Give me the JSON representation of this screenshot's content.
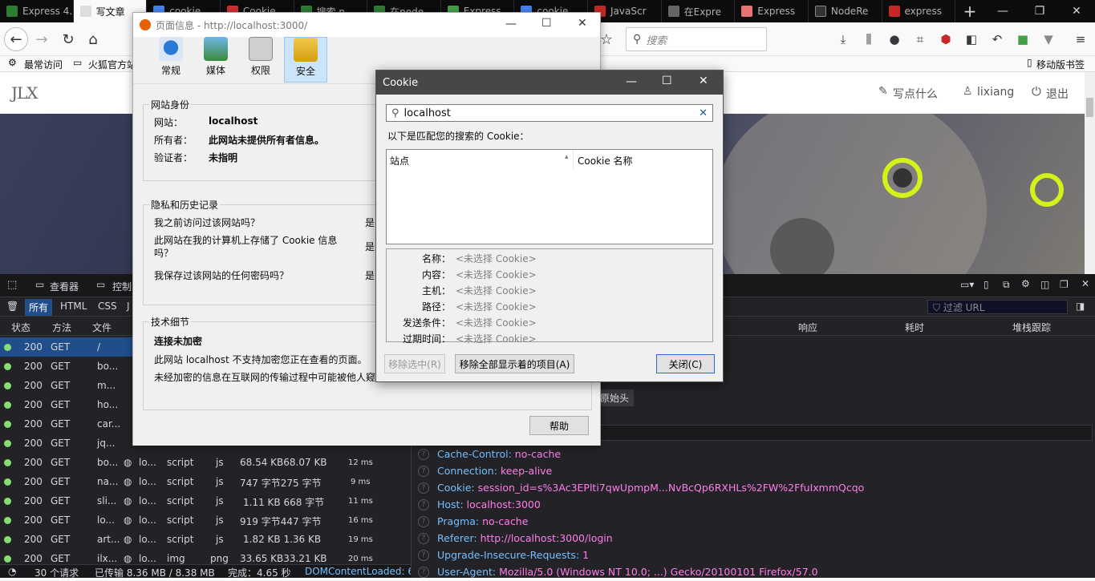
{
  "tabs": [
    {
      "label": "Express 4.x",
      "color": "#2e7d32"
    },
    {
      "label": "写文章",
      "color": "#eeeeee"
    },
    {
      "label": "cookie",
      "color": "#4285f4"
    },
    {
      "label": "Cookie",
      "color": "#d32f2f"
    },
    {
      "label": "搜索 n",
      "color": "#2e7d32"
    },
    {
      "label": "在node",
      "color": "#2e7d32"
    },
    {
      "label": "Express",
      "color": "#43a047"
    },
    {
      "label": "cookie",
      "color": "#4285f4"
    },
    {
      "label": "JavaScr",
      "color": "#c62828"
    },
    {
      "label": "在Expre",
      "color": "#555555"
    },
    {
      "label": "Express",
      "color": "#e57373"
    },
    {
      "label": "NodeRe",
      "color": "#222222"
    },
    {
      "label": "express",
      "color": "#c62828"
    }
  ],
  "toolbar": {
    "search_placeholder": "搜索",
    "mobile_bookmarks": "移动版书签"
  },
  "bookmarks": {
    "item1": "最常访问",
    "item2": "火狐官方站"
  },
  "site": {
    "logo": "JLX",
    "write": "写点什么",
    "user": "lixiang",
    "logout": "退出"
  },
  "pageinfo": {
    "title": "页面信息 - http://localhost:3000/",
    "tabs": [
      "常规",
      "媒体",
      "权限",
      "安全"
    ],
    "identity": {
      "heading": "网站身份",
      "site_label": "网站：",
      "site_value": "localhost",
      "owner_label": "所有者：",
      "owner_value": "此网站未提供所有者信息。",
      "verifier_label": "验证者：",
      "verifier_value": "未指明"
    },
    "privacy": {
      "heading": "隐私和历史记录",
      "q1": "我之前访问过该网站吗？",
      "a1": "是",
      "q2a": "此网站在我的计算机上存储了 Cookie 信息",
      "q2b": "吗？",
      "a2": "是",
      "q3": "我保存过该网站的任何密码吗？",
      "a3": "是"
    },
    "tech": {
      "heading": "技术细节",
      "line1": "连接未加密",
      "line2": "此网站 localhost 不支持加密您正在查看的页面。",
      "line3": "未经加密的信息在互联网的传输过程中可能被他人窥"
    },
    "help": "帮助"
  },
  "cookie": {
    "title": "Cookie",
    "search_value": "localhost",
    "matching_label": "以下是匹配您的搜索的 Cookie：",
    "col_site": "站点",
    "col_name": "Cookie 名称",
    "details": [
      {
        "label": "名称：",
        "value": "<未选择 Cookie>"
      },
      {
        "label": "内容：",
        "value": "<未选择 Cookie>"
      },
      {
        "label": "主机：",
        "value": "<未选择 Cookie>"
      },
      {
        "label": "路径：",
        "value": "<未选择 Cookie>"
      },
      {
        "label": "发送条件：",
        "value": "<未选择 Cookie>"
      },
      {
        "label": "过期时间：",
        "value": "<未选择 Cookie>"
      }
    ],
    "btn_remove_selected": "移除选中(R)",
    "btn_remove_all": "移除全部显示着的项目(A)",
    "btn_close": "关闭(C)"
  },
  "devtools": {
    "inspector": "查看器",
    "console": "控制",
    "filters": [
      "所有",
      "HTML",
      "CSS",
      "J"
    ],
    "filter_url": "过滤 URL",
    "cols": [
      "状态",
      "方法",
      "文件"
    ],
    "right_cols": [
      "响应",
      "耗时",
      "堆栈跟踪"
    ],
    "raw_headers": "原始头",
    "requests": [
      {
        "status": "200",
        "method": "GET",
        "file": "/",
        "domain": "",
        "cause": "",
        "type": "",
        "size": "",
        "time": ""
      },
      {
        "status": "200",
        "method": "GET",
        "file": "bo...",
        "domain": "",
        "cause": "",
        "type": "",
        "size": "",
        "time": ""
      },
      {
        "status": "200",
        "method": "GET",
        "file": "m...",
        "domain": "",
        "cause": "",
        "type": "",
        "size": "",
        "time": ""
      },
      {
        "status": "200",
        "method": "GET",
        "file": "ho...",
        "domain": "",
        "cause": "",
        "type": "",
        "size": "",
        "time": ""
      },
      {
        "status": "200",
        "method": "GET",
        "file": "car...",
        "domain": "",
        "cause": "",
        "type": "",
        "size": "",
        "time": ""
      },
      {
        "status": "200",
        "method": "GET",
        "file": "jq...",
        "domain": "",
        "cause": "",
        "type": "",
        "size": "",
        "time": ""
      },
      {
        "status": "200",
        "method": "GET",
        "file": "bo...",
        "domain": "lo...",
        "cause": "script",
        "type": "js",
        "size": "68.54 KB68.07 KB",
        "time": "12 ms"
      },
      {
        "status": "200",
        "method": "GET",
        "file": "na...",
        "domain": "lo...",
        "cause": "script",
        "type": "js",
        "size": "747 字节275 字节",
        "time": "9 ms"
      },
      {
        "status": "200",
        "method": "GET",
        "file": "sli...",
        "domain": "lo...",
        "cause": "script",
        "type": "js",
        "size": "1.11 KB 668 字节",
        "time": "11 ms"
      },
      {
        "status": "200",
        "method": "GET",
        "file": "lo...",
        "domain": "lo...",
        "cause": "script",
        "type": "js",
        "size": "919 字节447 字节",
        "time": "16 ms"
      },
      {
        "status": "200",
        "method": "GET",
        "file": "art...",
        "domain": "lo...",
        "cause": "script",
        "type": "js",
        "size": "1.82 KB  1.36 KB",
        "time": "19 ms"
      },
      {
        "status": "200",
        "method": "GET",
        "file": "ilx...",
        "domain": "lo...",
        "cause": "img",
        "type": "png",
        "size": "33.65 KB33.21 KB",
        "time": "20 ms"
      }
    ],
    "headers": [
      {
        "key": "Cache-Control:",
        "value": "no-cache"
      },
      {
        "key": "Connection:",
        "value": "keep-alive"
      },
      {
        "key": "Cookie:",
        "value": "session_id=s%3Ac3EPlti7qwUpmpM...NvBcQp6RXHLs%2FW%2FfuIxmmQcqo"
      },
      {
        "key": "Host:",
        "value": "localhost:3000"
      },
      {
        "key": "Pragma:",
        "value": "no-cache"
      },
      {
        "key": "Referer:",
        "value": "http://localhost:3000/login"
      },
      {
        "key": "Upgrade-Insecure-Requests:",
        "value": "1"
      },
      {
        "key": "User-Agent:",
        "value": "Mozilla/5.0 (Windows NT 10.0; ...) Gecko/20100101 Firefox/57.0"
      }
    ],
    "status": {
      "requests": "30 个请求",
      "transferred": "已传输 8.36 MB / 8.38 MB",
      "finish": "完成：4.65 秒",
      "dcl": "DOMContentLoaded: 6"
    }
  }
}
